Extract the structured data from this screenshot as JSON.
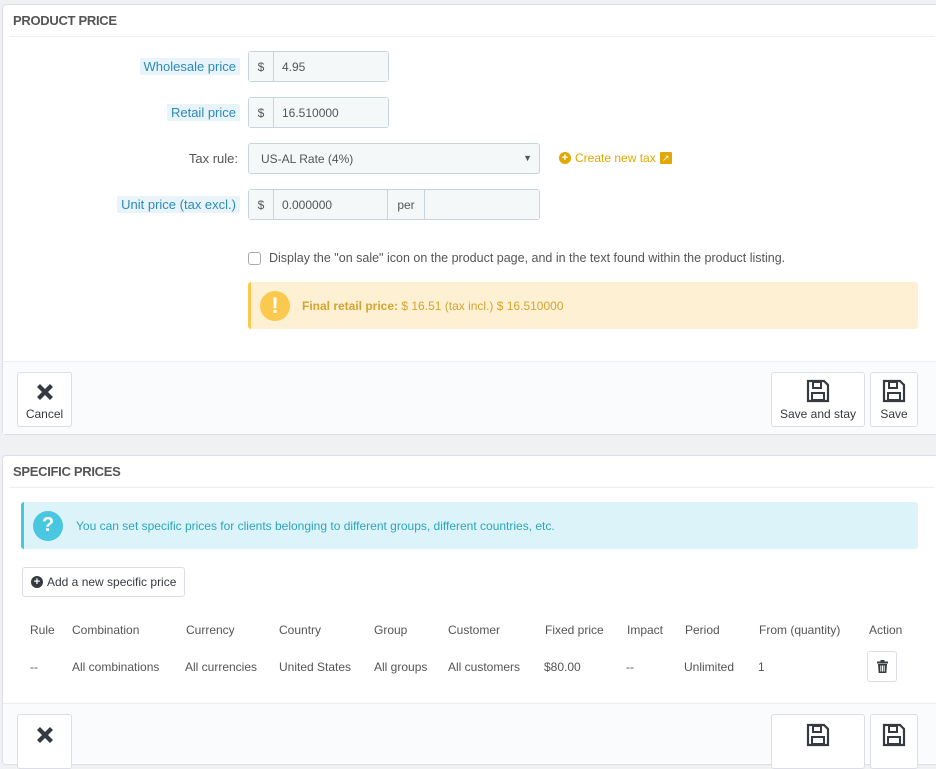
{
  "product_price": {
    "title": "PRODUCT PRICE",
    "wholesale": {
      "label": "Wholesale price",
      "currency": "$",
      "value": "4.95"
    },
    "retail": {
      "label": "Retail price",
      "currency": "$",
      "value": "16.510000"
    },
    "tax_rule": {
      "label": "Tax rule:",
      "selected": "US-AL Rate (4%)",
      "create_link": "Create new tax"
    },
    "unit_price": {
      "label": "Unit price (tax excl.)",
      "currency": "$",
      "value": "0.000000",
      "per_label": "per",
      "per_value": ""
    },
    "on_sale": {
      "label": "Display the \"on sale\" icon on the product page, and in the text found within the product listing.",
      "checked": false
    },
    "final_price": {
      "label": "Final retail price:",
      "text": "$ 16.51 (tax incl.) $ 16.510000"
    },
    "footer": {
      "cancel": "Cancel",
      "save_and_stay": "Save and stay",
      "save": "Save"
    }
  },
  "specific_prices": {
    "title": "SPECIFIC PRICES",
    "info": "You can set specific prices for clients belonging to different groups, different countries, etc.",
    "add_button": "Add a new specific price",
    "columns": [
      "Rule",
      "Combination",
      "Currency",
      "Country",
      "Group",
      "Customer",
      "Fixed price",
      "Impact",
      "Period",
      "From (quantity)",
      "Action"
    ],
    "rows": [
      [
        "--",
        "All combinations",
        "All currencies",
        "United States",
        "All groups",
        "All customers",
        "$80.00",
        "--",
        "Unlimited",
        "1"
      ]
    ]
  },
  "colors": {
    "label_highlight": "#2c8bb8",
    "warning": "#fcc94f",
    "info": "#4ac7e0",
    "link_yellow": "#e0a800"
  }
}
